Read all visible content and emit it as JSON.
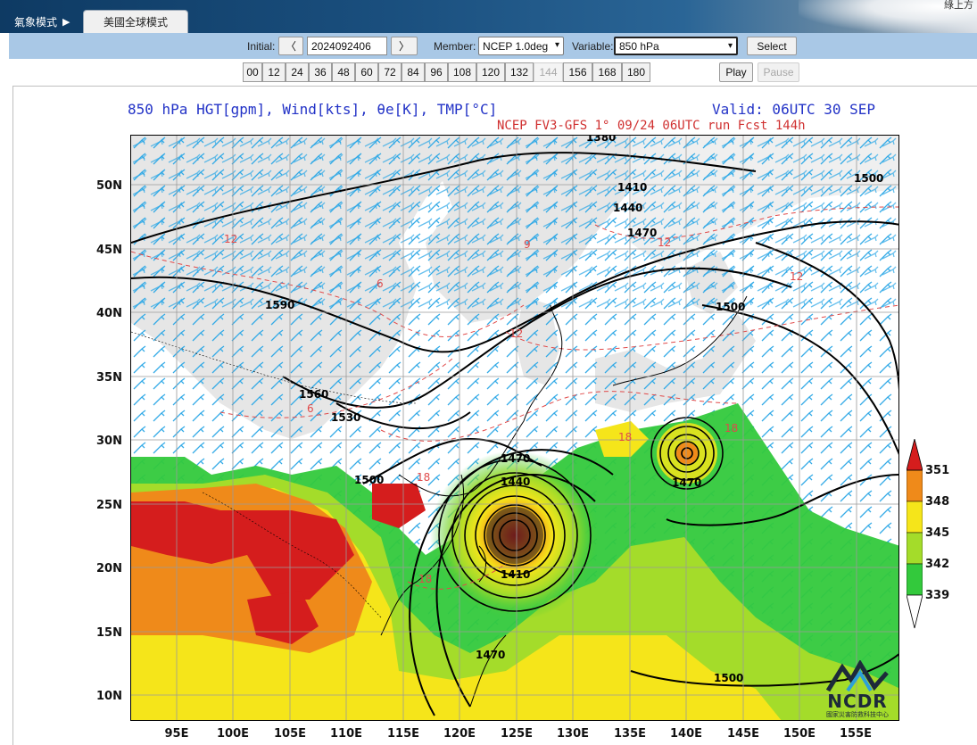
{
  "header": {
    "tab_weather_mode": "氣象模式",
    "tab_weather_arrow": "▶",
    "tab_us_global": "美國全球模式",
    "corner_text": "綠上方"
  },
  "controls": {
    "initial_label": "Initial:",
    "prev_label": "〈",
    "next_label": "〉",
    "initial_value": "2024092406",
    "member_label": "Member:",
    "member_value": "NCEP 1.0deg",
    "variable_label": "Variable:",
    "variable_value": "850 hPa",
    "select_label": "Select",
    "play_label": "Play",
    "pause_label": "Pause",
    "hours": [
      "00",
      "12",
      "24",
      "36",
      "48",
      "60",
      "72",
      "84",
      "96",
      "108",
      "120",
      "132",
      "144",
      "156",
      "168",
      "180"
    ],
    "disabled_hour": "144"
  },
  "map": {
    "title": "850 hPa  HGT[gpm], Wind[kts], θe[K], TMP[°C]",
    "valid": "Valid: 06UTC 30 SEP",
    "run_info": "NCEP FV3-GFS 1°  09/24 06UTC run  Fcst 144h",
    "lat_labels": [
      "50N",
      "45N",
      "40N",
      "35N",
      "30N",
      "25N",
      "20N",
      "15N",
      "10N"
    ],
    "lon_labels": [
      "95E",
      "100E",
      "105E",
      "110E",
      "115E",
      "120E",
      "125E",
      "130E",
      "135E",
      "140E",
      "145E",
      "150E",
      "155E"
    ],
    "contour_labels": {
      "h1380": "1380",
      "h1410a": "1410",
      "h1440a": "1440",
      "h1470a": "1470",
      "h1500a": "1500",
      "h1590": "1590",
      "h1560": "1560",
      "h1530": "1530",
      "h1500b": "1500",
      "h1500c": "1500",
      "h1470b": "1470",
      "h1440b": "1440",
      "h1410b": "1410",
      "h1470c": "1470",
      "h1470d": "1470",
      "h1500d": "1500"
    },
    "temp_labels": {
      "t6a": "6",
      "t6b": "6",
      "t9": "9",
      "t12a": "12",
      "t12b": "12",
      "t12c": "12",
      "t18a": "18",
      "t18b": "18",
      "t18c": "18",
      "t18d": "18",
      "t15": "12"
    },
    "colorbar": {
      "levels": [
        "351",
        "348",
        "345",
        "342",
        "339"
      ],
      "colors": [
        "#d51d1d",
        "#ef8a1a",
        "#f5e51a",
        "#a4dc2a",
        "#33c93c"
      ]
    },
    "logo": {
      "name": "NCDR",
      "subtitle": "國家災害防救科技中心"
    }
  }
}
